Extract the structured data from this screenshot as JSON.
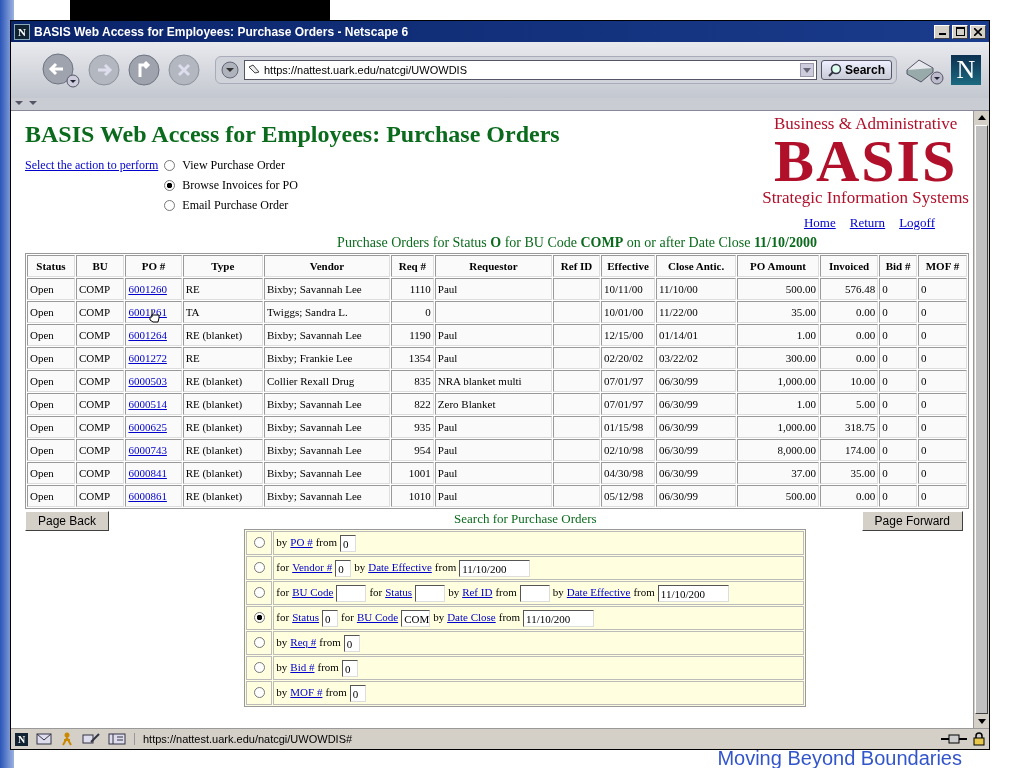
{
  "slide": {
    "footer": "Moving Beyond Boundaries"
  },
  "window": {
    "app_icon": "N",
    "title": "BASIS Web Access for Employees: Purchase Orders - Netscape 6"
  },
  "toolbar": {
    "url": "https://nattest.uark.edu/natcgi/UWOWDIS",
    "search_button": "Search",
    "brand_logo": "N"
  },
  "page": {
    "heading": "BASIS Web Access for Employees: Purchase Orders",
    "action_prompt": "Select the action to perform",
    "actions": [
      {
        "label": "View Purchase Order",
        "selected": false
      },
      {
        "label": "Browse Invoices for PO",
        "selected": true
      },
      {
        "label": "Email Purchase Order",
        "selected": false
      }
    ],
    "logo": {
      "top": "Business & Administrative",
      "main": "BASIS",
      "bottom": "Strategic Information Systems"
    },
    "nav_links": [
      "Home",
      "Return",
      "Logoff"
    ],
    "caption": "Purchase Orders for Status **O** for BU Code **COMP** on or after Date Close **11/10/2000**"
  },
  "table": {
    "columns": [
      "Status",
      "BU",
      "PO #",
      "Type",
      "Vendor",
      "Req #",
      "Requestor",
      "Ref ID",
      "Effective",
      "Close Antic.",
      "PO Amount",
      "Invoiced",
      "Bid #",
      "MOF #"
    ],
    "rows": [
      [
        "Open",
        "COMP",
        "6001260",
        "RE",
        "Bixby; Savannah Lee",
        "1110",
        "Paul",
        "",
        "10/11/00",
        "11/10/00",
        "500.00",
        "576.48",
        "0",
        "0"
      ],
      [
        "Open",
        "COMP",
        "6001261",
        "TA",
        "Twiggs; Sandra L.",
        "0",
        "",
        "",
        "10/01/00",
        "11/22/00",
        "35.00",
        "0.00",
        "0",
        "0"
      ],
      [
        "Open",
        "COMP",
        "6001264",
        "RE (blanket)",
        "Bixby; Savannah Lee",
        "1190",
        "Paul",
        "",
        "12/15/00",
        "01/14/01",
        "1.00",
        "0.00",
        "0",
        "0"
      ],
      [
        "Open",
        "COMP",
        "6001272",
        "RE",
        "Bixby; Frankie Lee",
        "1354",
        "Paul",
        "",
        "02/20/02",
        "03/22/02",
        "300.00",
        "0.00",
        "0",
        "0"
      ],
      [
        "Open",
        "COMP",
        "6000503",
        "RE (blanket)",
        "Collier Rexall Drug",
        "835",
        "NRA blanket multi",
        "",
        "07/01/97",
        "06/30/99",
        "1,000.00",
        "10.00",
        "0",
        "0"
      ],
      [
        "Open",
        "COMP",
        "6000514",
        "RE (blanket)",
        "Bixby; Savannah Lee",
        "822",
        "Zero Blanket",
        "",
        "07/01/97",
        "06/30/99",
        "1.00",
        "5.00",
        "0",
        "0"
      ],
      [
        "Open",
        "COMP",
        "6000625",
        "RE (blanket)",
        "Bixby; Savannah Lee",
        "935",
        "Paul",
        "",
        "01/15/98",
        "06/30/99",
        "1,000.00",
        "318.75",
        "0",
        "0"
      ],
      [
        "Open",
        "COMP",
        "6000743",
        "RE (blanket)",
        "Bixby; Savannah Lee",
        "954",
        "Paul",
        "",
        "02/10/98",
        "06/30/99",
        "8,000.00",
        "174.00",
        "0",
        "0"
      ],
      [
        "Open",
        "COMP",
        "6000841",
        "RE (blanket)",
        "Bixby; Savannah Lee",
        "1001",
        "Paul",
        "",
        "04/30/98",
        "06/30/99",
        "37.00",
        "35.00",
        "0",
        "0"
      ],
      [
        "Open",
        "COMP",
        "6000861",
        "RE (blanket)",
        "Bixby; Savannah Lee",
        "1010",
        "Paul",
        "",
        "05/12/98",
        "06/30/99",
        "500.00",
        "0.00",
        "0",
        "0"
      ]
    ]
  },
  "paging": {
    "back": "Page Back",
    "forward": "Page Forward"
  },
  "search": {
    "title": "Search for Purchase Orders",
    "options": [
      {
        "selected": false,
        "parts": [
          {
            "kind": "text",
            "text": "by"
          },
          {
            "kind": "link",
            "text": "PO #"
          },
          {
            "kind": "text",
            "text": "from"
          },
          {
            "kind": "field",
            "value": "0"
          }
        ]
      },
      {
        "selected": false,
        "parts": [
          {
            "kind": "text",
            "text": "for"
          },
          {
            "kind": "link",
            "text": "Vendor #"
          },
          {
            "kind": "field",
            "value": "0"
          },
          {
            "kind": "text",
            "text": "by"
          },
          {
            "kind": "link",
            "text": "Date Effective"
          },
          {
            "kind": "text",
            "text": "from"
          },
          {
            "kind": "field",
            "value": "11/10/200"
          }
        ]
      },
      {
        "selected": false,
        "parts": [
          {
            "kind": "text",
            "text": "for"
          },
          {
            "kind": "link",
            "text": "BU Code"
          },
          {
            "kind": "field"
          },
          {
            "kind": "text",
            "text": "for"
          },
          {
            "kind": "link",
            "text": "Status"
          },
          {
            "kind": "field"
          },
          {
            "kind": "text",
            "text": "by"
          },
          {
            "kind": "link",
            "text": "Ref ID"
          },
          {
            "kind": "text",
            "text": "from"
          },
          {
            "kind": "field"
          },
          {
            "kind": "text",
            "text": "by"
          },
          {
            "kind": "link",
            "text": "Date Effective"
          },
          {
            "kind": "text",
            "text": "from"
          },
          {
            "kind": "field",
            "value": "11/10/200"
          }
        ]
      },
      {
        "selected": true,
        "parts": [
          {
            "kind": "text",
            "text": "for"
          },
          {
            "kind": "link",
            "text": "Status"
          },
          {
            "kind": "field",
            "value": "0"
          },
          {
            "kind": "text",
            "text": "for"
          },
          {
            "kind": "link",
            "text": "BU Code"
          },
          {
            "kind": "field",
            "value": "COM"
          },
          {
            "kind": "text",
            "text": "by"
          },
          {
            "kind": "link",
            "text": "Date Close"
          },
          {
            "kind": "text",
            "text": "from"
          },
          {
            "kind": "field",
            "value": "11/10/200"
          }
        ]
      },
      {
        "selected": false,
        "parts": [
          {
            "kind": "text",
            "text": "by"
          },
          {
            "kind": "link",
            "text": "Req #"
          },
          {
            "kind": "text",
            "text": "from"
          },
          {
            "kind": "field",
            "value": "0"
          }
        ]
      },
      {
        "selected": false,
        "parts": [
          {
            "kind": "text",
            "text": "by"
          },
          {
            "kind": "link",
            "text": "Bid #"
          },
          {
            "kind": "text",
            "text": "from"
          },
          {
            "kind": "field",
            "value": "0"
          }
        ]
      },
      {
        "selected": false,
        "parts": [
          {
            "kind": "text",
            "text": "by"
          },
          {
            "kind": "link",
            "text": "MOF #"
          },
          {
            "kind": "text",
            "text": "from"
          },
          {
            "kind": "field",
            "value": "0"
          }
        ]
      }
    ]
  },
  "status_bar": {
    "app_icon": "N",
    "url": "https://nattest.uark.edu/natcgi/UWOWDIS#"
  }
}
